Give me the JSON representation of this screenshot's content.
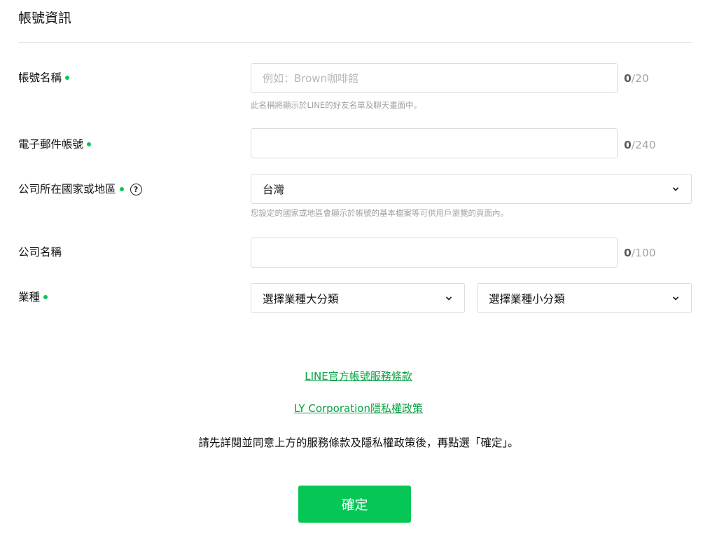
{
  "section": {
    "title": "帳號資訊"
  },
  "account_name": {
    "label": "帳號名稱",
    "placeholder": "例如：Brown咖啡館",
    "value": "",
    "counter_current": "0",
    "counter_max": "/20",
    "hint": "此名稱將顯示於LINE的好友名單及聊天畫面中。"
  },
  "email": {
    "label": "電子郵件帳號",
    "value": "",
    "counter_current": "0",
    "counter_max": "/240"
  },
  "country": {
    "label": "公司所在國家或地區",
    "help_icon": "question-circle-icon",
    "selected": "台灣",
    "hint": "您設定的國家或地區會顯示於帳號的基本檔案等可供用戶瀏覽的頁面內。"
  },
  "company": {
    "label": "公司名稱",
    "value": "",
    "counter_current": "0",
    "counter_max": "/100"
  },
  "industry": {
    "label": "業種",
    "major_selected": "選擇業種大分類",
    "minor_selected": "選擇業種小分類"
  },
  "links": {
    "terms": "LINE官方帳號服務條款",
    "privacy": "LY Corporation隱私權政策"
  },
  "notice": "請先詳閱並同意上方的服務條款及隱私權政策後，再點選「確定」。",
  "confirm_label": "確定",
  "colors": {
    "accent": "#06c755",
    "link": "#06a140",
    "hint": "#a0a0a0",
    "border": "#dcdcdc"
  }
}
